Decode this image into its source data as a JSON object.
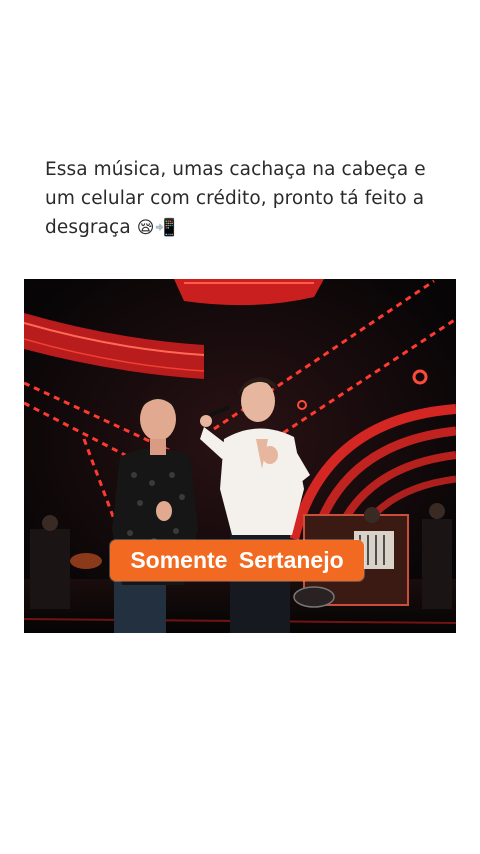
{
  "post": {
    "caption_line1": "Essa música, umas cachaça na cabeça e",
    "caption_line2": "um celular com crédito, pronto tá feito a",
    "caption_line3": "desgraça",
    "caption_emojis": "😪📲"
  },
  "video": {
    "watermark": "Somente  Sertanejo",
    "accent_color": "#f26a21",
    "stage_light_color": "#e0302a"
  }
}
